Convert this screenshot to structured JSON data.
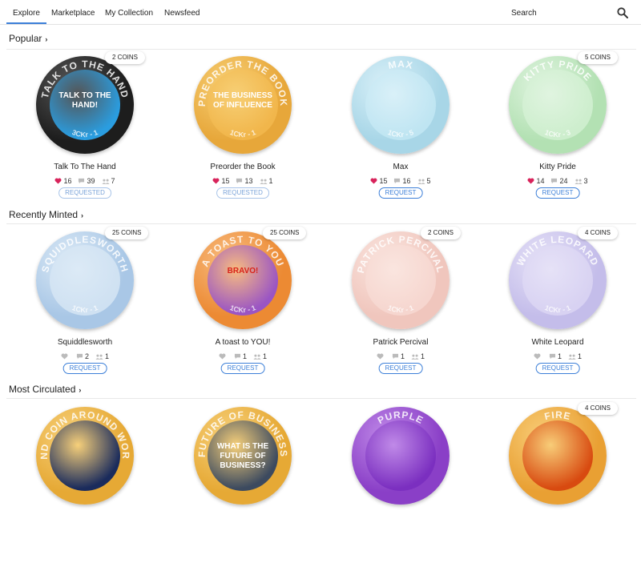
{
  "nav": {
    "tabs": [
      {
        "label": "Explore",
        "active": true
      },
      {
        "label": "Marketplace",
        "active": false
      },
      {
        "label": "My Collection",
        "active": false
      },
      {
        "label": "Newsfeed",
        "active": false
      }
    ],
    "search_placeholder": "Search"
  },
  "colors": {
    "accent": "#3c7fd8",
    "heart_active": "#d8235b",
    "heart_inactive": "#bbbbbb"
  },
  "sections": [
    {
      "title": "Popular",
      "cards": [
        {
          "name": "Talk To The Hand",
          "badge": "2 COINS",
          "likes": "16",
          "liked": true,
          "comments": "39",
          "holders": "7",
          "button": "REQUESTED",
          "ring_top": "TALK TO THE HAND",
          "ring_bottom": "3CKr - 1",
          "center_text": "TALK TO THE HAND!"
        },
        {
          "name": "Preorder the Book",
          "badge": "",
          "likes": "15",
          "liked": true,
          "comments": "13",
          "holders": "1",
          "button": "REQUESTED",
          "ring_top": "PREORDER THE BOOK",
          "ring_bottom": "1CKr - 1",
          "center_text": "THE BUSINESS OF INFLUENCE"
        },
        {
          "name": "Max",
          "badge": "",
          "likes": "15",
          "liked": true,
          "comments": "16",
          "holders": "5",
          "button": "REQUEST",
          "ring_top": "MAX",
          "ring_bottom": "1CKr - 5",
          "center_text": ""
        },
        {
          "name": "Kitty Pride",
          "badge": "5 COINS",
          "likes": "14",
          "liked": true,
          "comments": "24",
          "holders": "3",
          "button": "REQUEST",
          "ring_top": "KITTY PRIDE",
          "ring_bottom": "1CKr - 3",
          "center_text": ""
        }
      ]
    },
    {
      "title": "Recently Minted",
      "cards": [
        {
          "name": "Squiddlesworth",
          "badge": "25 COINS",
          "likes": "",
          "liked": false,
          "comments": "2",
          "holders": "1",
          "button": "REQUEST",
          "ring_top": "SQUIDDLESWORTH",
          "ring_bottom": "1CKr - 1",
          "center_text": ""
        },
        {
          "name": "A toast to YOU!",
          "badge": "25 COINS",
          "likes": "",
          "liked": false,
          "comments": "1",
          "holders": "1",
          "button": "REQUEST",
          "ring_top": "A TOAST TO YOU",
          "ring_bottom": "1CKr - 1",
          "center_text": "BRAVO!"
        },
        {
          "name": "Patrick Percival",
          "badge": "2 COINS",
          "likes": "",
          "liked": false,
          "comments": "1",
          "holders": "1",
          "button": "REQUEST",
          "ring_top": "PATRICK PERCIVAL",
          "ring_bottom": "1CKr - 1",
          "center_text": ""
        },
        {
          "name": "White Leopard",
          "badge": "4 COINS",
          "likes": "",
          "liked": false,
          "comments": "1",
          "holders": "1",
          "button": "REQUEST",
          "ring_top": "WHITE LEOPARD",
          "ring_bottom": "1CKr - 1",
          "center_text": ""
        }
      ]
    },
    {
      "title": "Most Circulated",
      "cards": [
        {
          "name": "",
          "badge": "",
          "likes": "",
          "liked": false,
          "comments": "",
          "holders": "",
          "button": "",
          "ring_top": "SEND COIN AROUND WORLD",
          "ring_bottom": "",
          "center_text": ""
        },
        {
          "name": "",
          "badge": "",
          "likes": "",
          "liked": false,
          "comments": "",
          "holders": "",
          "button": "",
          "ring_top": "FUTURE OF BUSINESS",
          "ring_bottom": "",
          "center_text": "WHAT IS THE FUTURE OF BUSINESS?"
        },
        {
          "name": "",
          "badge": "",
          "likes": "",
          "liked": false,
          "comments": "",
          "holders": "",
          "button": "",
          "ring_top": "PURPLE",
          "ring_bottom": "",
          "center_text": ""
        },
        {
          "name": "",
          "badge": "4 COINS",
          "likes": "",
          "liked": false,
          "comments": "",
          "holders": "",
          "button": "",
          "ring_top": "FIRE",
          "ring_bottom": "",
          "center_text": ""
        }
      ]
    }
  ]
}
